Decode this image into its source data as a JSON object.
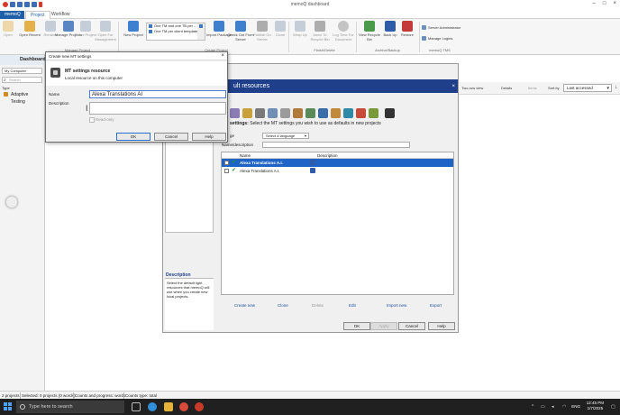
{
  "window": {
    "title": "memoQ dashboard",
    "controls": [
      "–",
      "□",
      "×"
    ]
  },
  "tabs": [
    {
      "label": "memoQ"
    },
    {
      "label": "Project"
    },
    {
      "label": "Workflow"
    }
  ],
  "ribbon": {
    "buttons": [
      {
        "label": "Open",
        "enabled": false
      },
      {
        "label": "Open Recent",
        "enabled": true
      },
      {
        "label": "Rename",
        "enabled": false
      },
      {
        "label": "Manage Projects",
        "enabled": true
      },
      {
        "label": "Clone Project",
        "enabled": false
      },
      {
        "label": "Open For Management",
        "enabled": false
      },
      {
        "label": "New Project",
        "enabled": true
      },
      {
        "label": "Import Package",
        "enabled": true
      },
      {
        "label": "Check Out From Server",
        "enabled": true
      },
      {
        "label": "Publish On Server",
        "enabled": false
      },
      {
        "label": "Clone",
        "enabled": false
      },
      {
        "label": "Wrap Up",
        "enabled": false
      },
      {
        "label": "Move To Recycle Bin",
        "enabled": false
      },
      {
        "label": "Log Time For Document",
        "enabled": false
      },
      {
        "label": "View Recycle Bin",
        "enabled": true
      },
      {
        "label": "Back Up",
        "enabled": true
      },
      {
        "label": "Restore",
        "enabled": true
      }
    ],
    "templates": [
      "One TM and one TB per ...",
      "One TM per client template"
    ],
    "groups": [
      "Manage Project",
      "Create Project",
      "Finish/Delete",
      "Archive/Backup",
      "memoQ TMS"
    ],
    "tms": [
      "Server Administrator",
      "Manage Logins"
    ]
  },
  "nav": {
    "title": "Dashboard",
    "computer": "My Computer",
    "search_placeholder": "Search",
    "type_label": "Type",
    "item": "Adaptive Testing"
  },
  "toolbar_right": {
    "two_row_view": "Two-row view",
    "details": "Details",
    "items": "Items",
    "sort_by": "Sort by",
    "sort_value": "Last accessed"
  },
  "project_settings": {
    "header": "ult resources",
    "tree": [
      "Miscellaneous",
      "Privacy"
    ],
    "heading_bold": "settings:",
    "heading_rest": "Select the MT settings you wish to use as defaults in new projects",
    "lang_label": "ge",
    "lang_value": "Select a language",
    "namedesc_label": "Name/description",
    "columns": [
      "Name",
      "Description"
    ],
    "rows": [
      {
        "name": "Alexa Translations A.I.",
        "selected": true,
        "checked": true
      },
      {
        "name": "Alexa Translations A.I.",
        "selected": false,
        "checked": false
      }
    ],
    "links": [
      {
        "label": "Create new",
        "enabled": true
      },
      {
        "label": "Clone",
        "enabled": true
      },
      {
        "label": "Delete",
        "enabled": false
      },
      {
        "label": "Edit",
        "enabled": true
      },
      {
        "label": "Import new",
        "enabled": true
      },
      {
        "label": "Export",
        "enabled": true
      }
    ],
    "description_title": "Description",
    "description_text": "Select the default light resources that memoQ will use when you create new local projects.",
    "buttons": [
      {
        "label": "OK",
        "enabled": true
      },
      {
        "label": "Apply",
        "enabled": false
      },
      {
        "label": "Cancel",
        "enabled": true
      },
      {
        "label": "Help",
        "enabled": true
      }
    ]
  },
  "mt_dialog": {
    "title": "Create new MT settings",
    "heading": "MT settings resource",
    "subheading": "Local resource on this computer",
    "name_label": "Name",
    "name_value": "Alexa Translations AI",
    "description_label": "Description",
    "readonly_label": "Read-only",
    "ok": "OK",
    "cancel": "Cancel",
    "help": "Help"
  },
  "statusbar": {
    "projects": "2 projects",
    "selected": "Selected: 0 projects (0 words)",
    "counts": "Counts and progress: words",
    "counts_type": "Counts type: total"
  },
  "taskbar": {
    "search_placeholder": "Type here to search",
    "language": "ENG",
    "time": "12:45 PM",
    "date": "1/7/2025"
  },
  "colors": {
    "accent": "#1f5fa8",
    "dialog_header": "#1f3f8a",
    "selection": "#1f63c6"
  }
}
